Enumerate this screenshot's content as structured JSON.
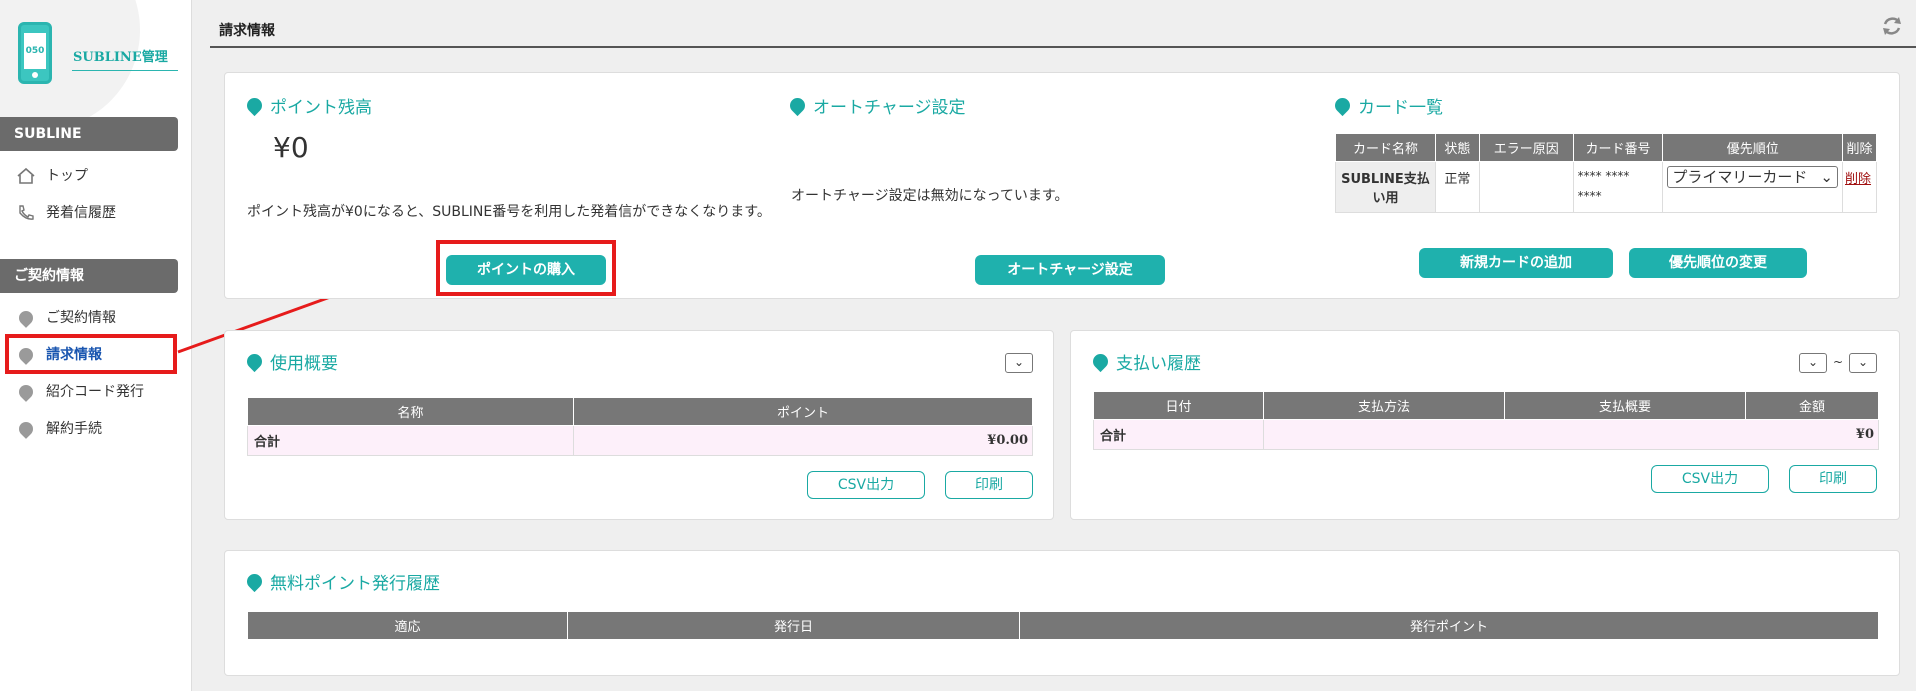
{
  "sidebar": {
    "logo_text": "050",
    "brand": "SUBLINE管理",
    "sections": [
      {
        "title": "SUBLINE",
        "items": [
          {
            "label": "トップ",
            "icon": "home-icon"
          },
          {
            "label": "発着信履歴",
            "icon": "phone-icon"
          }
        ]
      },
      {
        "title": "ご契約情報",
        "items": [
          {
            "label": "ご契約情報",
            "icon": "pin-icon"
          },
          {
            "label": "請求情報",
            "icon": "pin-icon",
            "active": true
          },
          {
            "label": "紹介コード発行",
            "icon": "pin-icon"
          },
          {
            "label": "解約手続",
            "icon": "pin-icon"
          }
        ]
      }
    ]
  },
  "header": {
    "title": "請求情報"
  },
  "points": {
    "title": "ポイント残高",
    "balance": "¥0",
    "note": "ポイント残高が¥0になると、SUBLINE番号を利用した発着信ができなくなります。",
    "buy_button": "ポイントの購入"
  },
  "autocharge": {
    "title": "オートチャージ設定",
    "status": "オートチャージ設定は無効になっています。",
    "button": "オートチャージ設定"
  },
  "cards": {
    "title": "カード一覧",
    "columns": [
      "カード名称",
      "状態",
      "エラー原因",
      "カード番号",
      "優先順位",
      "削除"
    ],
    "rows": [
      {
        "name": "SUBLINE支払い用",
        "status": "正常",
        "error": "",
        "number_1": "**** ****",
        "number_2": "****",
        "priority": "プライマリーカード",
        "delete": "削除"
      }
    ],
    "add_button": "新規カードの追加",
    "priority_button": "優先順位の変更"
  },
  "usage": {
    "title": "使用概要",
    "columns": [
      "名称",
      "ポイント"
    ],
    "total_label": "合計",
    "total_value": "¥0.00",
    "csv_button": "CSV出力",
    "print_button": "印刷"
  },
  "payments": {
    "title": "支払い履歴",
    "range_sep": "~",
    "columns": [
      "日付",
      "支払方法",
      "支払概要",
      "金額"
    ],
    "total_label": "合計",
    "total_value": "¥0",
    "csv_button": "CSV出力",
    "print_button": "印刷"
  },
  "free_points": {
    "title": "無料ポイント発行履歴",
    "columns": [
      "適応",
      "発行日",
      "発行ポイント"
    ]
  },
  "colors": {
    "accent": "#1fb1ad",
    "highlight": "#e61b1b",
    "header_gray": "#777777"
  }
}
